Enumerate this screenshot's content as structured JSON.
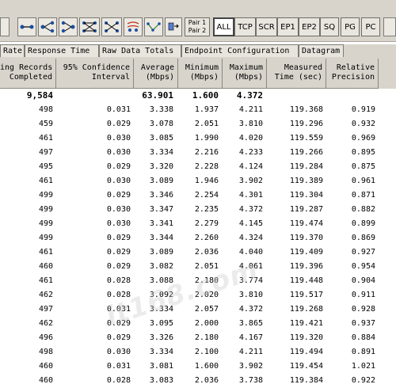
{
  "toolbar": {
    "pair_label_line1": "Pair 1",
    "pair_label_line2": "Pair 2",
    "filters": [
      "ALL",
      "TCP",
      "SCR",
      "EP1",
      "EP2",
      "SQ",
      "PG",
      "PC"
    ],
    "active_filter": "ALL"
  },
  "tabs": [
    "Rate",
    "Response Time",
    "Raw Data Totals",
    "Endpoint Configuration",
    "Datagram"
  ],
  "columns": [
    "ing Records\nCompleted",
    "95% Confidence\nInterval",
    "Average\n(Mbps)",
    "Minimum\n(Mbps)",
    "Maximum\n(Mbps)",
    "Measured\nTime (sec)",
    "Relative\nPrecision"
  ],
  "totals": [
    "9,584",
    "",
    "63.901",
    "1.600",
    "4.372",
    "",
    ""
  ],
  "rows": [
    [
      "498",
      "0.031",
      "3.338",
      "1.937",
      "4.211",
      "119.368",
      "0.919"
    ],
    [
      "459",
      "0.029",
      "3.078",
      "2.051",
      "3.810",
      "119.296",
      "0.932"
    ],
    [
      "461",
      "0.030",
      "3.085",
      "1.990",
      "4.020",
      "119.559",
      "0.969"
    ],
    [
      "497",
      "0.030",
      "3.334",
      "2.216",
      "4.233",
      "119.266",
      "0.895"
    ],
    [
      "495",
      "0.029",
      "3.320",
      "2.228",
      "4.124",
      "119.284",
      "0.875"
    ],
    [
      "461",
      "0.030",
      "3.089",
      "1.946",
      "3.902",
      "119.389",
      "0.961"
    ],
    [
      "499",
      "0.029",
      "3.346",
      "2.254",
      "4.301",
      "119.304",
      "0.871"
    ],
    [
      "499",
      "0.030",
      "3.347",
      "2.235",
      "4.372",
      "119.287",
      "0.882"
    ],
    [
      "499",
      "0.030",
      "3.341",
      "2.279",
      "4.145",
      "119.474",
      "0.899"
    ],
    [
      "499",
      "0.029",
      "3.344",
      "2.260",
      "4.324",
      "119.370",
      "0.869"
    ],
    [
      "461",
      "0.029",
      "3.089",
      "2.036",
      "4.040",
      "119.409",
      "0.927"
    ],
    [
      "460",
      "0.029",
      "3.082",
      "2.051",
      "4.061",
      "119.396",
      "0.954"
    ],
    [
      "461",
      "0.028",
      "3.088",
      "2.180",
      "3.774",
      "119.448",
      "0.904"
    ],
    [
      "462",
      "0.028",
      "3.092",
      "2.020",
      "3.810",
      "119.517",
      "0.911"
    ],
    [
      "497",
      "0.031",
      "3.334",
      "2.057",
      "4.372",
      "119.268",
      "0.928"
    ],
    [
      "462",
      "0.029",
      "3.095",
      "2.000",
      "3.865",
      "119.421",
      "0.937"
    ],
    [
      "496",
      "0.029",
      "3.326",
      "2.180",
      "4.167",
      "119.320",
      "0.884"
    ],
    [
      "498",
      "0.030",
      "3.334",
      "2.100",
      "4.211",
      "119.494",
      "0.891"
    ],
    [
      "460",
      "0.031",
      "3.081",
      "1.600",
      "3.902",
      "119.454",
      "1.021"
    ],
    [
      "460",
      "0.028",
      "3.083",
      "2.036",
      "3.738",
      "119.384",
      "0.922"
    ]
  ]
}
